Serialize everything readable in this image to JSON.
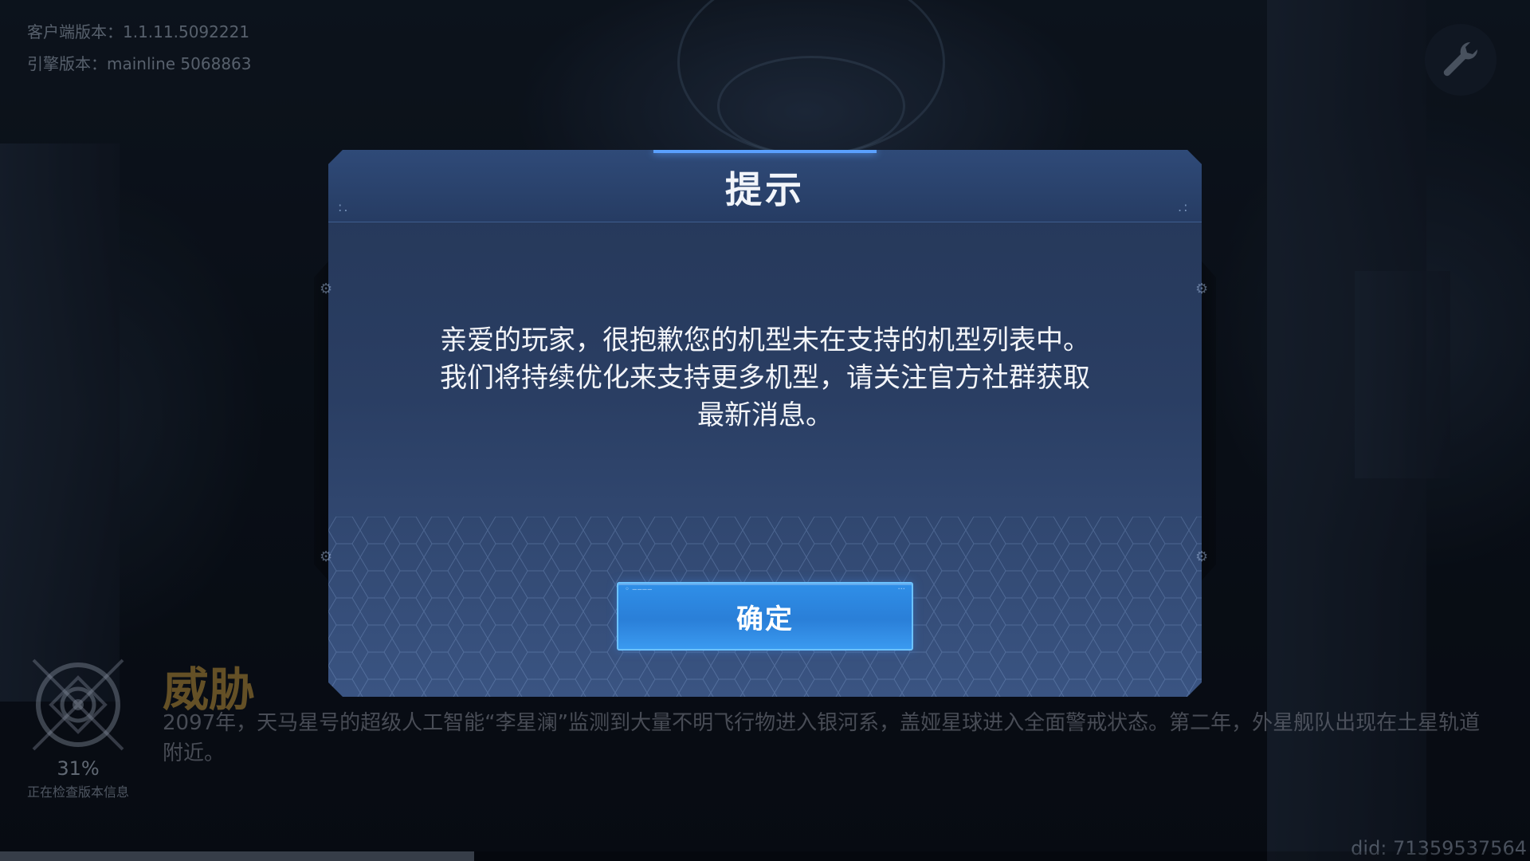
{
  "version_info": {
    "client_version": "客户端版本：1.1.11.5092221",
    "engine_version": "引擎版本：mainline 5068863"
  },
  "tools": {
    "icon": "wrench-icon"
  },
  "dialog": {
    "title": "提示",
    "message": "亲爱的玩家，很抱歉您的机型未在支持的机型列表中。我们将持续优化来支持更多机型，请关注官方社群获取最新消息。",
    "confirm_label": "确定"
  },
  "loading": {
    "percent": "31%",
    "progress_fraction": 0.31,
    "status": "正在检查版本信息"
  },
  "story": {
    "title": "威胁",
    "text": "2097年，天马星号的超级人工智能“李星澜”监测到大量不明飞行物进入银河系，盖娅星球进入全面警戒状态。第二年，外星舰队出现在土星轨道附近。"
  },
  "device": {
    "did": "did: 71359537564"
  },
  "colors": {
    "dialog_bg": "#2a3e63",
    "button_bg": "#2a7fd8",
    "button_border": "#6cc2ff",
    "story_title": "#8c6e2d"
  }
}
